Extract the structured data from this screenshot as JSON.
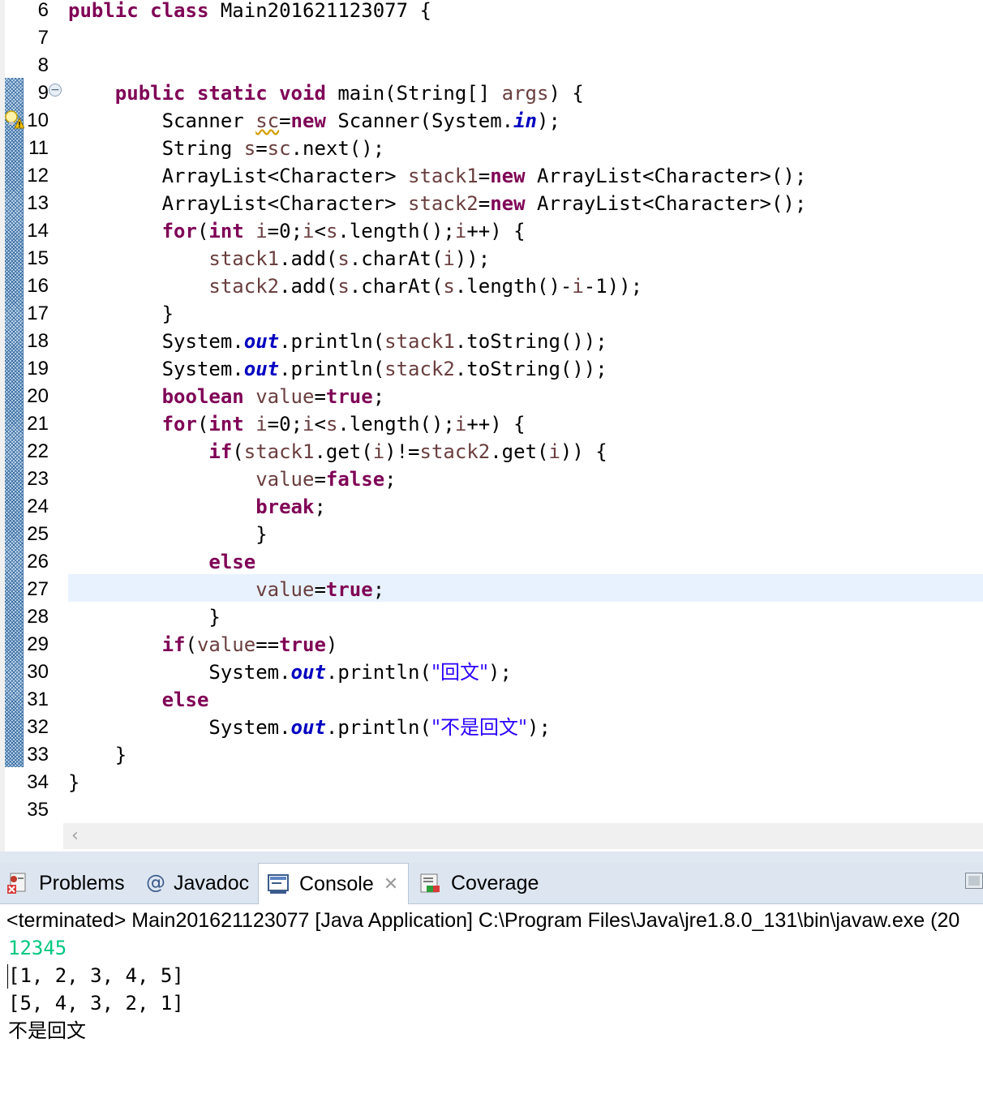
{
  "editor": {
    "first_line_number": 6,
    "line_numbers": [
      "6",
      "7",
      "8",
      "9",
      "10",
      "11",
      "12",
      "13",
      "14",
      "15",
      "16",
      "17",
      "18",
      "19",
      "20",
      "21",
      "22",
      "23",
      "24",
      "25",
      "26",
      "27",
      "28",
      "29",
      "30",
      "31",
      "32",
      "33",
      "34",
      "35"
    ],
    "current_line": "27",
    "lines": [
      [
        {
          "t": "public",
          "c": "kw"
        },
        {
          "t": " "
        },
        {
          "t": "class",
          "c": "kw"
        },
        {
          "t": " Main201621123077 {"
        }
      ],
      [],
      [],
      [
        {
          "t": "    "
        },
        {
          "t": "public",
          "c": "kw"
        },
        {
          "t": " "
        },
        {
          "t": "static",
          "c": "kw"
        },
        {
          "t": " "
        },
        {
          "t": "void",
          "c": "kw"
        },
        {
          "t": " main(String[] "
        },
        {
          "t": "args",
          "c": "lv"
        },
        {
          "t": ") {"
        }
      ],
      [
        {
          "t": "        Scanner "
        },
        {
          "t": "sc",
          "c": "lv sq"
        },
        {
          "t": "="
        },
        {
          "t": "new",
          "c": "kw"
        },
        {
          "t": " Scanner(System."
        },
        {
          "t": "in",
          "c": "fld"
        },
        {
          "t": ");"
        }
      ],
      [
        {
          "t": "        String "
        },
        {
          "t": "s",
          "c": "lv"
        },
        {
          "t": "="
        },
        {
          "t": "sc",
          "c": "lv"
        },
        {
          "t": ".next();"
        }
      ],
      [
        {
          "t": "        ArrayList<Character> "
        },
        {
          "t": "stack1",
          "c": "lv"
        },
        {
          "t": "="
        },
        {
          "t": "new",
          "c": "kw"
        },
        {
          "t": " ArrayList<Character>();"
        }
      ],
      [
        {
          "t": "        ArrayList<Character> "
        },
        {
          "t": "stack2",
          "c": "lv"
        },
        {
          "t": "="
        },
        {
          "t": "new",
          "c": "kw"
        },
        {
          "t": " ArrayList<Character>();"
        }
      ],
      [
        {
          "t": "        "
        },
        {
          "t": "for",
          "c": "kw"
        },
        {
          "t": "("
        },
        {
          "t": "int",
          "c": "kw"
        },
        {
          "t": " "
        },
        {
          "t": "i",
          "c": "lv"
        },
        {
          "t": "=0;"
        },
        {
          "t": "i",
          "c": "lv"
        },
        {
          "t": "<"
        },
        {
          "t": "s",
          "c": "lv"
        },
        {
          "t": ".length();"
        },
        {
          "t": "i",
          "c": "lv"
        },
        {
          "t": "++) {"
        }
      ],
      [
        {
          "t": "            "
        },
        {
          "t": "stack1",
          "c": "lv"
        },
        {
          "t": ".add("
        },
        {
          "t": "s",
          "c": "lv"
        },
        {
          "t": ".charAt("
        },
        {
          "t": "i",
          "c": "lv"
        },
        {
          "t": "));"
        }
      ],
      [
        {
          "t": "            "
        },
        {
          "t": "stack2",
          "c": "lv"
        },
        {
          "t": ".add("
        },
        {
          "t": "s",
          "c": "lv"
        },
        {
          "t": ".charAt("
        },
        {
          "t": "s",
          "c": "lv"
        },
        {
          "t": ".length()-"
        },
        {
          "t": "i",
          "c": "lv"
        },
        {
          "t": "-1));"
        }
      ],
      [
        {
          "t": "        }"
        }
      ],
      [
        {
          "t": "        System."
        },
        {
          "t": "out",
          "c": "fld"
        },
        {
          "t": ".println("
        },
        {
          "t": "stack1",
          "c": "lv"
        },
        {
          "t": ".toString());"
        }
      ],
      [
        {
          "t": "        System."
        },
        {
          "t": "out",
          "c": "fld"
        },
        {
          "t": ".println("
        },
        {
          "t": "stack2",
          "c": "lv"
        },
        {
          "t": ".toString());"
        }
      ],
      [
        {
          "t": "        "
        },
        {
          "t": "boolean",
          "c": "kw"
        },
        {
          "t": " "
        },
        {
          "t": "value",
          "c": "lv"
        },
        {
          "t": "="
        },
        {
          "t": "true",
          "c": "kw"
        },
        {
          "t": ";"
        }
      ],
      [
        {
          "t": "        "
        },
        {
          "t": "for",
          "c": "kw"
        },
        {
          "t": "("
        },
        {
          "t": "int",
          "c": "kw"
        },
        {
          "t": " "
        },
        {
          "t": "i",
          "c": "lv"
        },
        {
          "t": "=0;"
        },
        {
          "t": "i",
          "c": "lv"
        },
        {
          "t": "<"
        },
        {
          "t": "s",
          "c": "lv"
        },
        {
          "t": ".length();"
        },
        {
          "t": "i",
          "c": "lv"
        },
        {
          "t": "++) {"
        }
      ],
      [
        {
          "t": "            "
        },
        {
          "t": "if",
          "c": "kw"
        },
        {
          "t": "("
        },
        {
          "t": "stack1",
          "c": "lv"
        },
        {
          "t": ".get("
        },
        {
          "t": "i",
          "c": "lv"
        },
        {
          "t": ")!="
        },
        {
          "t": "stack2",
          "c": "lv"
        },
        {
          "t": ".get("
        },
        {
          "t": "i",
          "c": "lv"
        },
        {
          "t": ")) {"
        }
      ],
      [
        {
          "t": "                "
        },
        {
          "t": "value",
          "c": "lv"
        },
        {
          "t": "="
        },
        {
          "t": "false",
          "c": "kw"
        },
        {
          "t": ";"
        }
      ],
      [
        {
          "t": "                "
        },
        {
          "t": "break",
          "c": "kw"
        },
        {
          "t": ";"
        }
      ],
      [
        {
          "t": "                }"
        }
      ],
      [
        {
          "t": "            "
        },
        {
          "t": "else",
          "c": "kw"
        }
      ],
      [
        {
          "t": "                "
        },
        {
          "t": "value",
          "c": "lv"
        },
        {
          "t": "="
        },
        {
          "t": "true",
          "c": "kw"
        },
        {
          "t": ";"
        }
      ],
      [
        {
          "t": "            }"
        }
      ],
      [
        {
          "t": "        "
        },
        {
          "t": "if",
          "c": "kw"
        },
        {
          "t": "("
        },
        {
          "t": "value",
          "c": "lv"
        },
        {
          "t": "=="
        },
        {
          "t": "true",
          "c": "kw"
        },
        {
          "t": ")"
        }
      ],
      [
        {
          "t": "            System."
        },
        {
          "t": "out",
          "c": "fld"
        },
        {
          "t": ".println("
        },
        {
          "t": "\"回文\"",
          "c": "str"
        },
        {
          "t": ");"
        }
      ],
      [
        {
          "t": "        "
        },
        {
          "t": "else",
          "c": "kw"
        }
      ],
      [
        {
          "t": "            System."
        },
        {
          "t": "out",
          "c": "fld"
        },
        {
          "t": ".println("
        },
        {
          "t": "\"不是回文\"",
          "c": "str"
        },
        {
          "t": ");"
        }
      ],
      [
        {
          "t": "    }"
        }
      ],
      [
        {
          "t": "}"
        }
      ],
      []
    ]
  },
  "colors": {
    "keyword": "#7f0055",
    "local_variable": "#6a3e3e",
    "static_field": "#0000c0",
    "string": "#2a00ff",
    "current_line_bg": "#e8f2fe",
    "console_input": "#00c87f"
  },
  "panel": {
    "tabs": [
      {
        "label": "Problems",
        "icon": "problems-icon"
      },
      {
        "label": "Javadoc",
        "icon": "javadoc-icon"
      },
      {
        "label": "Console",
        "icon": "console-icon",
        "active": true
      },
      {
        "label": "Coverage",
        "icon": "coverage-icon"
      }
    ]
  },
  "console": {
    "status": "<terminated> Main201621123077 [Java Application] C:\\Program Files\\Java\\jre1.8.0_131\\bin\\javaw.exe (20",
    "input": "12345",
    "output": [
      "[1, 2, 3, 4, 5]",
      "[5, 4, 3, 2, 1]",
      "不是回文"
    ]
  }
}
